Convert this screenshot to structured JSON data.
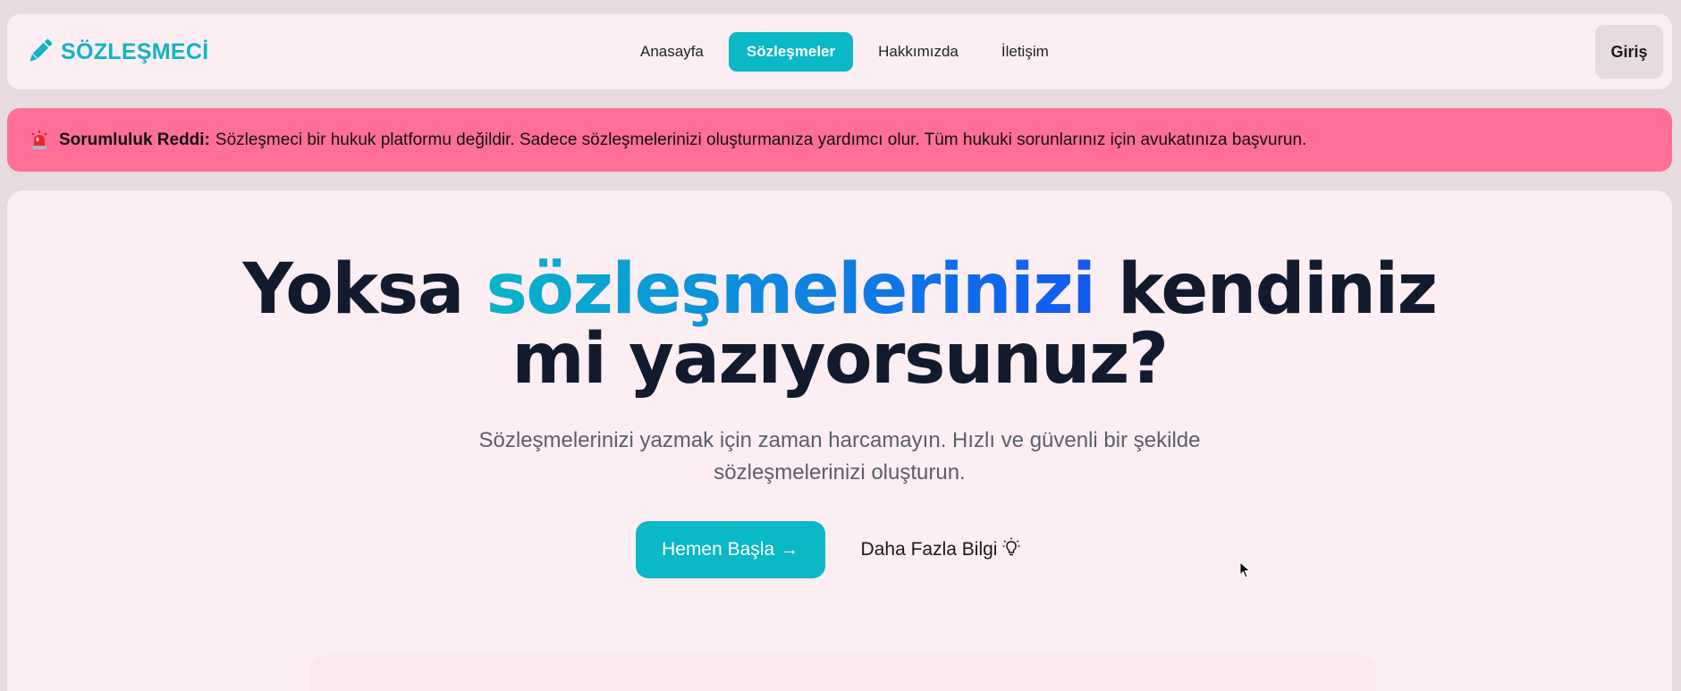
{
  "nav": {
    "logo_text": "SÖZLEŞMECİ",
    "logo_icon": "pencil-icon",
    "links": [
      {
        "label": "Anasayfa",
        "active": false
      },
      {
        "label": "Sözleşmeler",
        "active": true
      },
      {
        "label": "Hakkımızda",
        "active": false
      },
      {
        "label": "İletişim",
        "active": false
      }
    ],
    "login_label": "Giriş"
  },
  "disclaimer": {
    "icon": "siren-icon",
    "label": "Sorumluluk Reddi:",
    "text": "Sözleşmeci bir hukuk platformu değildir. Sadece sözleşmelerinizi oluşturmanıza yardımcı olur. Tüm hukuki sorunlarınız için avukatınıza başvurun."
  },
  "hero": {
    "title_part1": "Yoksa ",
    "title_highlight": "sözleşmelerinizi",
    "title_part2": " kendiniz",
    "title_line2": "mi yazıyorsunuz?",
    "subtitle_line1": "Sözleşmelerinizi yazmak için zaman harcamayın. Hızlı ve güvenli bir şekilde",
    "subtitle_line2": "sözleşmelerinizi oluşturun.",
    "primary_cta": "Hemen Başla →",
    "secondary_cta": "Daha Fazla Bilgi",
    "secondary_icon": "lightbulb-icon"
  },
  "colors": {
    "accent": "#0ab8c6",
    "alert": "#ff6f96",
    "background": "#fdeef3",
    "headline": "#121a2e"
  }
}
